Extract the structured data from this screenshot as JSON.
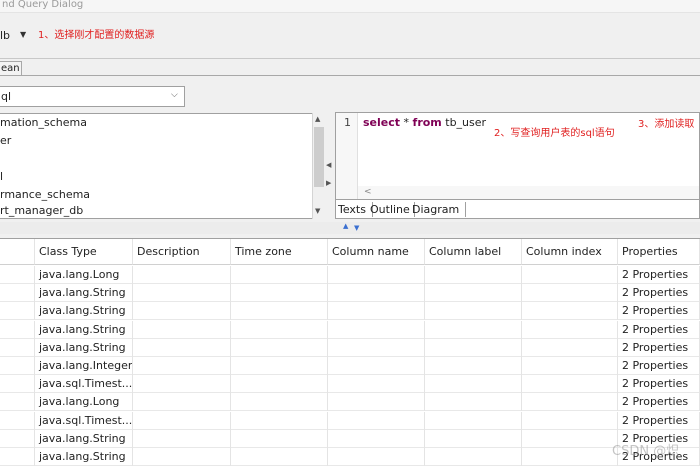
{
  "window": {
    "title": "nd Query Dialog"
  },
  "datasource": {
    "value": "lb"
  },
  "annotations": {
    "step1": "1、选择刚才配置的数据源",
    "step2": "2、写查询用户表的sql语句",
    "step3": "3、添加读取"
  },
  "tabs": [
    {
      "label": "ean"
    }
  ],
  "database_select": {
    "value": "ql"
  },
  "schema_list": [
    "mation_schema",
    "er",
    "",
    "l",
    "rmance_schema",
    "rt_manager_db"
  ],
  "editor": {
    "line_number": "1",
    "sql": {
      "kw1": "select",
      "star": " * ",
      "kw2": "from",
      "table": "  tb_user"
    },
    "tabs": [
      "Texts",
      "Outline",
      "Diagram"
    ]
  },
  "grid": {
    "columns": [
      "",
      "Class Type",
      "Description",
      "Time zone",
      "Column name",
      "Column label",
      "Column index",
      "Properties"
    ],
    "rows": [
      [
        "java.lang.Long",
        "2 Properties"
      ],
      [
        "java.lang.String",
        "2 Properties"
      ],
      [
        "java.lang.String",
        "2 Properties"
      ],
      [
        "java.lang.String",
        "2 Properties"
      ],
      [
        "java.lang.String",
        "2 Properties"
      ],
      [
        "java.lang.Integer",
        "2 Properties"
      ],
      [
        "java.sql.Timest...",
        "2 Properties"
      ],
      [
        "java.lang.Long",
        "2 Properties"
      ],
      [
        "java.sql.Timest...",
        "2 Properties"
      ],
      [
        "java.lang.String",
        "2 Properties"
      ],
      [
        "java.lang.String",
        "2 Properties"
      ]
    ]
  },
  "watermark": "CSDN @炽"
}
